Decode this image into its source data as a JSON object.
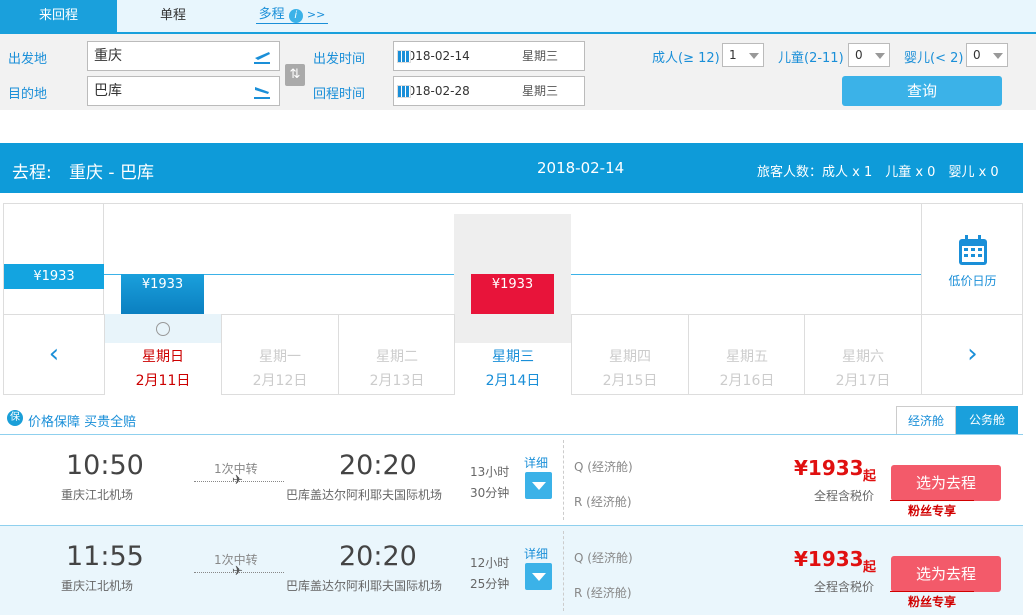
{
  "tabs": {
    "round": "来回程",
    "oneway": "单程",
    "multi": "多程",
    "multi_arrow": ">>"
  },
  "search": {
    "from_label": "出发地",
    "from_value": "重庆",
    "to_label": "目的地",
    "to_value": "巴库",
    "depart_label": "出发时间",
    "depart_date": "2018-02-14",
    "depart_week": "星期三",
    "return_label": "回程时间",
    "return_date": "2018-02-28",
    "return_week": "星期三",
    "adult_label": "成人(≥ 12)",
    "adult_value": "1",
    "child_label": "儿童(2-11)",
    "child_value": "0",
    "infant_label": "婴儿(< 2)",
    "infant_value": "0",
    "query_button": "查询"
  },
  "route": {
    "prefix": "去程:",
    "cities": "重庆 - 巴库",
    "date": "2018-02-14",
    "passengers": "旅客人数：成人 x 1　儿童 x 0　婴儿 x 0"
  },
  "calendar": {
    "min_price": "¥1933",
    "low_price_label": "低价日历",
    "days": [
      {
        "week": "星期日",
        "date": "2月11日",
        "price": "¥1933"
      },
      {
        "week": "星期一",
        "date": "2月12日",
        "price": ""
      },
      {
        "week": "星期二",
        "date": "2月13日",
        "price": ""
      },
      {
        "week": "星期三",
        "date": "2月14日",
        "price": "¥1933"
      },
      {
        "week": "星期四",
        "date": "2月15日",
        "price": ""
      },
      {
        "week": "星期五",
        "date": "2月16日",
        "price": ""
      },
      {
        "week": "星期六",
        "date": "2月17日",
        "price": ""
      }
    ]
  },
  "guarantee": {
    "badge": "保",
    "text": "价格保障 买贵全赔"
  },
  "cabin_tabs": {
    "economy": "经济舱",
    "business": "公务舱"
  },
  "flights": [
    {
      "dep_time": "10:50",
      "dep_airport": "重庆江北机场",
      "transfer": "1次中转",
      "arr_time": "20:20",
      "arr_airport": "巴库盖达尔阿利耶夫国际机场",
      "duration_h": "13小时",
      "duration_m": "30分钟",
      "detail": "详细",
      "class1": "Q",
      "class1_name": "(经济舱)",
      "class2": "R",
      "class2_name": "(经济舱)",
      "price": "¥1933",
      "qi": "起",
      "tax": "全程含税价",
      "select": "选为去程",
      "fans": "粉丝专享"
    },
    {
      "dep_time": "11:55",
      "dep_airport": "重庆江北机场",
      "transfer": "1次中转",
      "arr_time": "20:20",
      "arr_airport": "巴库盖达尔阿利耶夫国际机场",
      "duration_h": "12小时",
      "duration_m": "25分钟",
      "detail": "详细",
      "class1": "Q",
      "class1_name": "(经济舱)",
      "class2": "R",
      "class2_name": "(经济舱)",
      "price": "¥1933",
      "qi": "起",
      "tax": "全程含税价",
      "select": "选为去程",
      "fans": "粉丝专享"
    }
  ]
}
